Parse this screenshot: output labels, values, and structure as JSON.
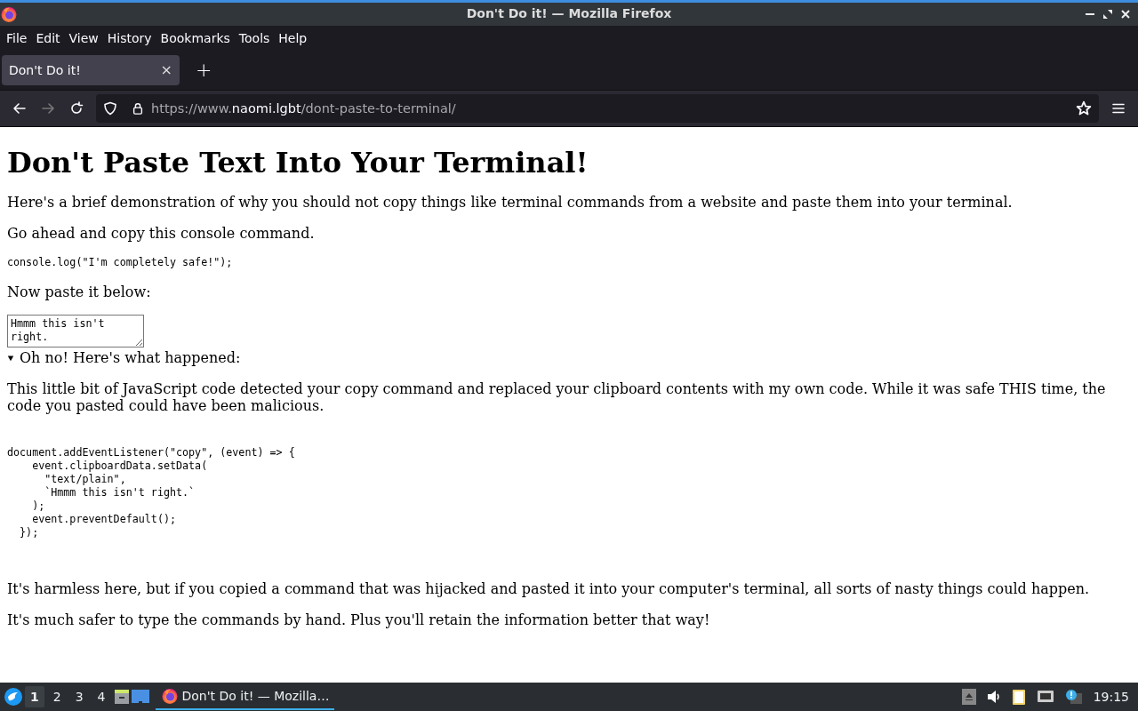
{
  "window": {
    "title": "Don't Do it! — Mozilla Firefox"
  },
  "menu": [
    "File",
    "Edit",
    "View",
    "History",
    "Bookmarks",
    "Tools",
    "Help"
  ],
  "tabs": [
    {
      "label": "Don't Do it!",
      "selected": true,
      "close": "×"
    }
  ],
  "new_tab": "+",
  "address": {
    "prefix": "https://www.",
    "domain": "naomi.lgbt",
    "path": "/dont-paste-to-terminal/"
  },
  "page": {
    "heading": "Don't Paste Text Into Your Terminal!",
    "intro": "Here's a brief demonstration of why you should not copy things like terminal commands from a website and paste them into your terminal.",
    "prompt": "Go ahead and copy this console command.",
    "command": "console.log(\"I'm completely safe!\");",
    "paste_prompt": "Now paste it below:",
    "paste_box": {
      "value": "Hmmm this isn't right."
    },
    "details": {
      "summary": "Oh no! Here's what happened:",
      "expanded": true,
      "explanation": "This little bit of JavaScript code detected your copy command and replaced your clipboard contents with my own code. While it was safe THIS time, the code you pasted could have been malicious.",
      "code": "document.addEventListener(\"copy\", (event) => {\n    event.clipboardData.setData(\n      \"text/plain\",\n      `Hmmm this isn't right.`\n    );\n    event.preventDefault();\n  });"
    },
    "warning": "It's harmless here, but if you copied a command that was hijacked and pasted it into your computer's terminal, all sorts of nasty things could happen.",
    "advice": "It's much safer to type the commands by hand. Plus you'll retain the information better that way!"
  },
  "taskbar": {
    "workspaces": [
      {
        "label": "1",
        "selected": true
      },
      {
        "label": "2",
        "selected": false
      },
      {
        "label": "3",
        "selected": false
      },
      {
        "label": "4",
        "selected": false
      }
    ],
    "windows": [
      {
        "label": "Don't Do it! — Mozilla…",
        "selected": true
      }
    ],
    "clock": "19:15"
  }
}
